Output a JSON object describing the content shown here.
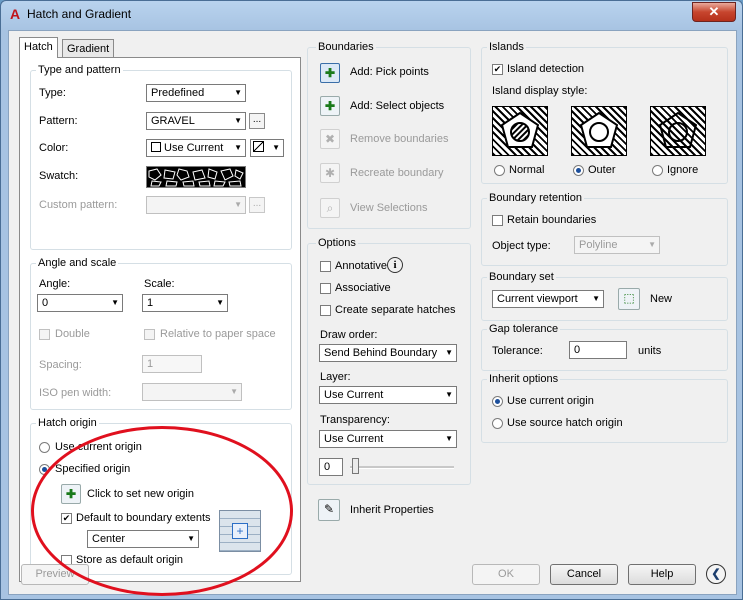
{
  "window": {
    "title": "Hatch and Gradient",
    "close_label": "✕"
  },
  "tabs": [
    {
      "label": "Hatch"
    },
    {
      "label": "Gradient"
    }
  ],
  "type_and_pattern": {
    "title": "Type and pattern",
    "type_label": "Type:",
    "type_value": "Predefined",
    "pattern_label": "Pattern:",
    "pattern_value": "GRAVEL",
    "browse_label": "...",
    "color_label": "Color:",
    "color_value": "Use Current",
    "bgcolor_symbol": "☐",
    "swatch_label": "Swatch:",
    "custom_pattern_label": "Custom pattern:",
    "custom_pattern_value": ""
  },
  "angle_and_scale": {
    "title": "Angle and scale",
    "angle_label": "Angle:",
    "angle_value": "0",
    "scale_label": "Scale:",
    "scale_value": "1",
    "double_label": "Double",
    "relative_label": "Relative to paper space",
    "spacing_label": "Spacing:",
    "spacing_value": "1",
    "iso_pen_label": "ISO pen width:",
    "iso_pen_value": ""
  },
  "hatch_origin": {
    "title": "Hatch origin",
    "use_current_label": "Use current origin",
    "specified_label": "Specified origin",
    "click_set_label": "Click to set new origin",
    "default_extents_label": "Default to boundary extents",
    "extents_value": "Center",
    "store_default_label": "Store as default origin"
  },
  "boundaries": {
    "title": "Boundaries",
    "add_pick": "Add: Pick points",
    "add_select": "Add: Select objects",
    "remove": "Remove boundaries",
    "recreate": "Recreate boundary",
    "view": "View Selections"
  },
  "options": {
    "title": "Options",
    "annotative_label": "Annotative",
    "associative_label": "Associative",
    "separate_label": "Create separate hatches",
    "draw_order_label": "Draw order:",
    "draw_order_value": "Send Behind Boundary",
    "layer_label": "Layer:",
    "layer_value": "Use Current",
    "transparency_label": "Transparency:",
    "transparency_value": "Use Current",
    "transparency_amount": "0"
  },
  "inherit_properties": {
    "label": "Inherit Properties"
  },
  "islands": {
    "title": "Islands",
    "detection_label": "Island detection",
    "style_label": "Island display style:",
    "normal_label": "Normal",
    "outer_label": "Outer",
    "ignore_label": "Ignore"
  },
  "boundary_retention": {
    "title": "Boundary retention",
    "retain_label": "Retain boundaries",
    "object_type_label": "Object type:",
    "object_type_value": "Polyline"
  },
  "boundary_set": {
    "title": "Boundary set",
    "value": "Current viewport",
    "new_label": "New"
  },
  "gap_tolerance": {
    "title": "Gap tolerance",
    "tolerance_label": "Tolerance:",
    "tolerance_value": "0",
    "units_label": "units"
  },
  "inherit_options": {
    "title": "Inherit options",
    "use_current_label": "Use current origin",
    "use_source_label": "Use source hatch origin"
  },
  "footer": {
    "preview": "Preview",
    "ok": "OK",
    "cancel": "Cancel",
    "help": "Help",
    "more_symbol": "❮"
  },
  "colors": {
    "window_frame": "#a7c3e2",
    "annotation_ellipse": "#e0101e",
    "close_button": "#c7452e"
  }
}
